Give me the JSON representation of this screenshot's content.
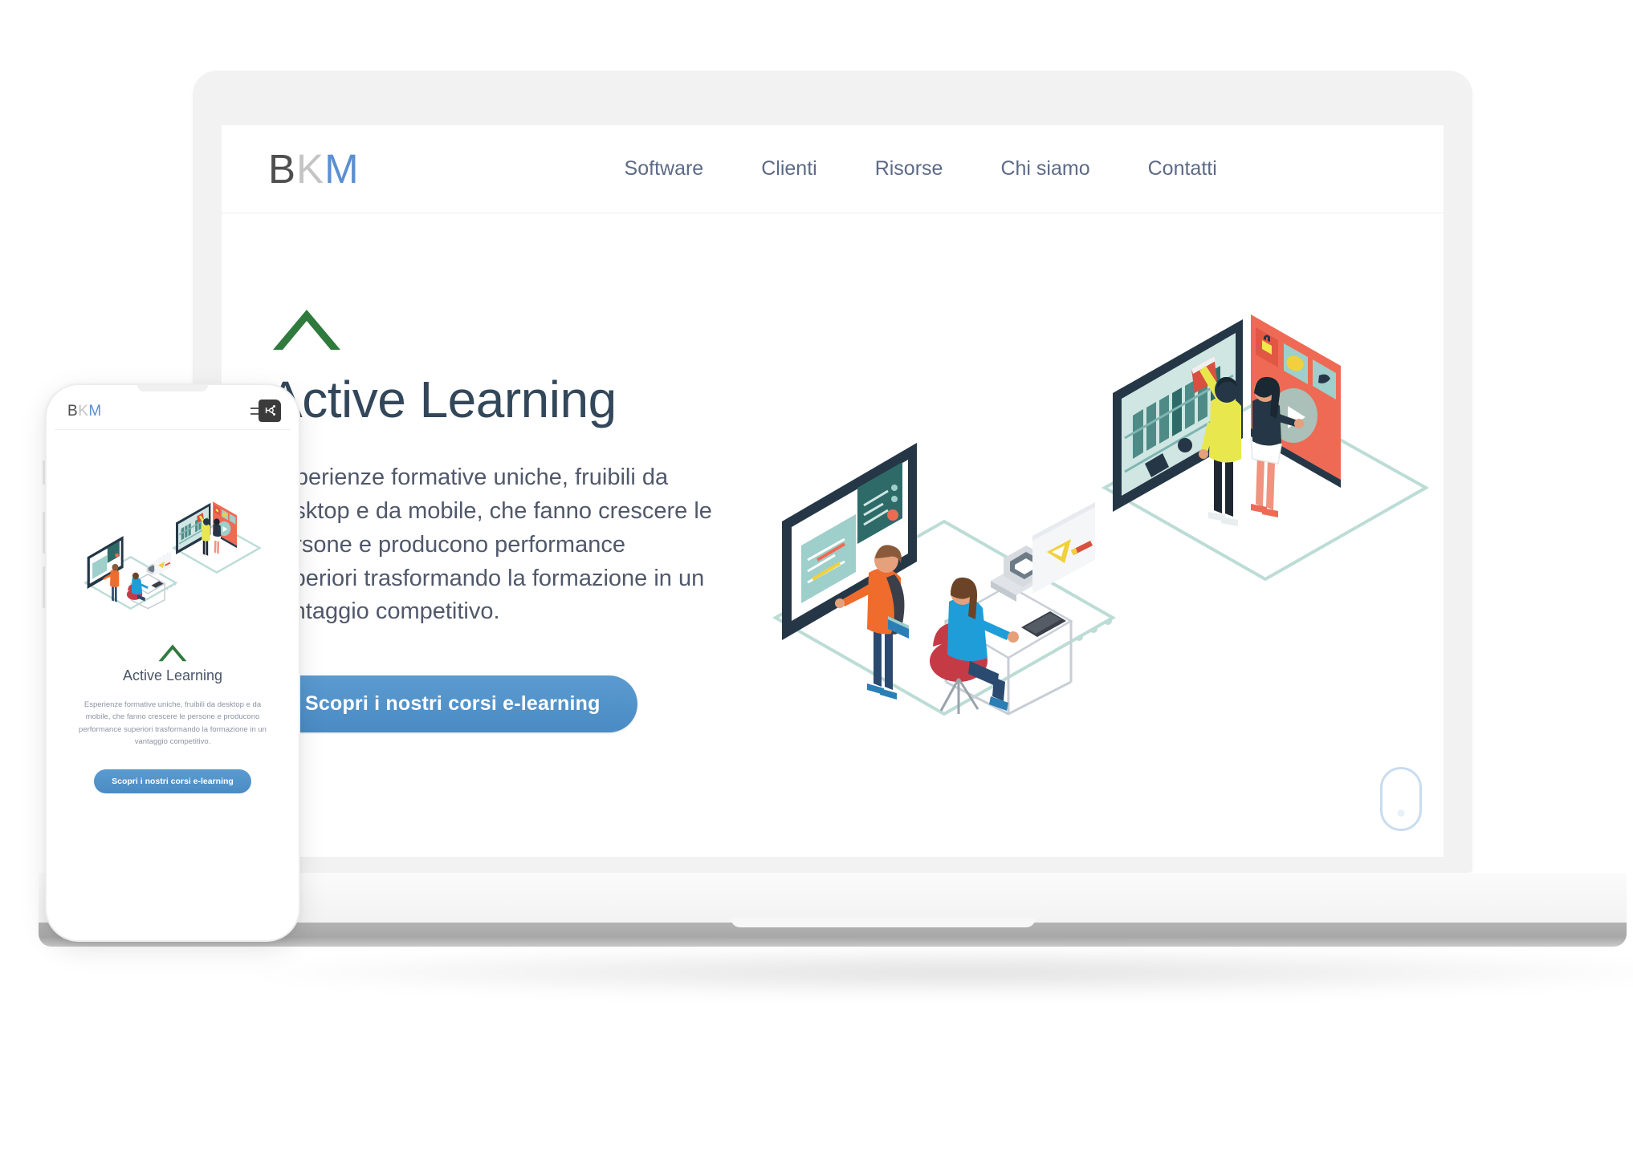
{
  "brand": {
    "letters": [
      "B",
      "K",
      "M"
    ],
    "colors": {
      "b": "#4f4f4f",
      "k": "#c4c4c4",
      "m": "#5b8fd4"
    }
  },
  "nav": {
    "items": [
      {
        "label": "Software"
      },
      {
        "label": "Clienti"
      },
      {
        "label": "Risorse"
      },
      {
        "label": "Chi siamo"
      },
      {
        "label": "Contatti"
      }
    ]
  },
  "hero": {
    "title": "Active Learning",
    "paragraph": "Esperienze formative uniche, fruibili da desktop e da mobile, che fanno crescere le persone e producono performance superiori trasformando la formazione in un vantaggio competitivo.",
    "cta_label": "Scopri i nostri corsi e-learning",
    "accent_green": "#2f7a3d",
    "cta_color": "#4a8bc4",
    "title_color": "#33475b"
  },
  "phone": {
    "title": "Active Learning",
    "paragraph": "Esperienze formative uniche, fruibili da desktop e da mobile, che fanno crescere le persone e producono performance superiori trasformando la formazione in un vantaggio competitivo.",
    "cta_label": "Scopri i nostri corsi e-learning",
    "menu_icon": "hamburger-menu-icon",
    "badge_icon": "sprocket-icon"
  },
  "illustration": {
    "name": "isometric-e-learning-illustration",
    "palette": {
      "dark_navy": "#253746",
      "teal": "#9ecfca",
      "coral": "#ef6a54",
      "orange": "#ef6c2c",
      "yellow": "#f2e74b",
      "blue": "#1f9dd9",
      "red_chair": "#c43b46",
      "platform_line": "#bcdcd6"
    }
  },
  "mouse_indicator": {
    "name": "mouse-pointer-pill",
    "color": "#c9dcf0"
  }
}
